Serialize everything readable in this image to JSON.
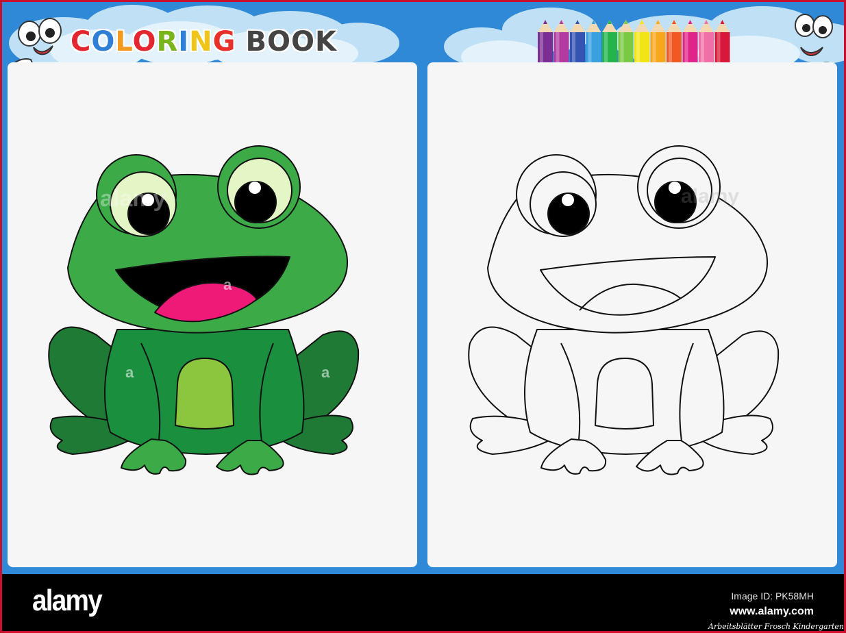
{
  "header": {
    "title_word1": "COLORING",
    "title_word2": "BOOK",
    "title_colors": [
      "#e3262f",
      "#2e7fd6",
      "#f29a1f",
      "#e3262f",
      "#7ab51d",
      "#2e7fd6",
      "#f0c419",
      "#e8302a"
    ],
    "title_word2_color": "#444444"
  },
  "pencil_colors": [
    "#7b2e93",
    "#b23aa0",
    "#3454b4",
    "#3aa0e0",
    "#25b34b",
    "#7ac943",
    "#f3e515",
    "#f7a71b",
    "#f05a22",
    "#e0248a",
    "#f06fa6",
    "#d7183a"
  ],
  "pages": {
    "left": {
      "description_name": "colored-frog",
      "frog_green": "#3cab47",
      "frog_dark_green": "#1e7a35",
      "belly": "#8cc63f",
      "tongue": "#ef1a77"
    },
    "right": {
      "description_name": "outline-frog"
    }
  },
  "footer": {
    "brand": "alamy",
    "image_id": "Image ID: PK58MH",
    "url": "www.alamy.com",
    "caption": "Arbeitsblätter Frosch Kindergarten"
  },
  "watermark": "a"
}
